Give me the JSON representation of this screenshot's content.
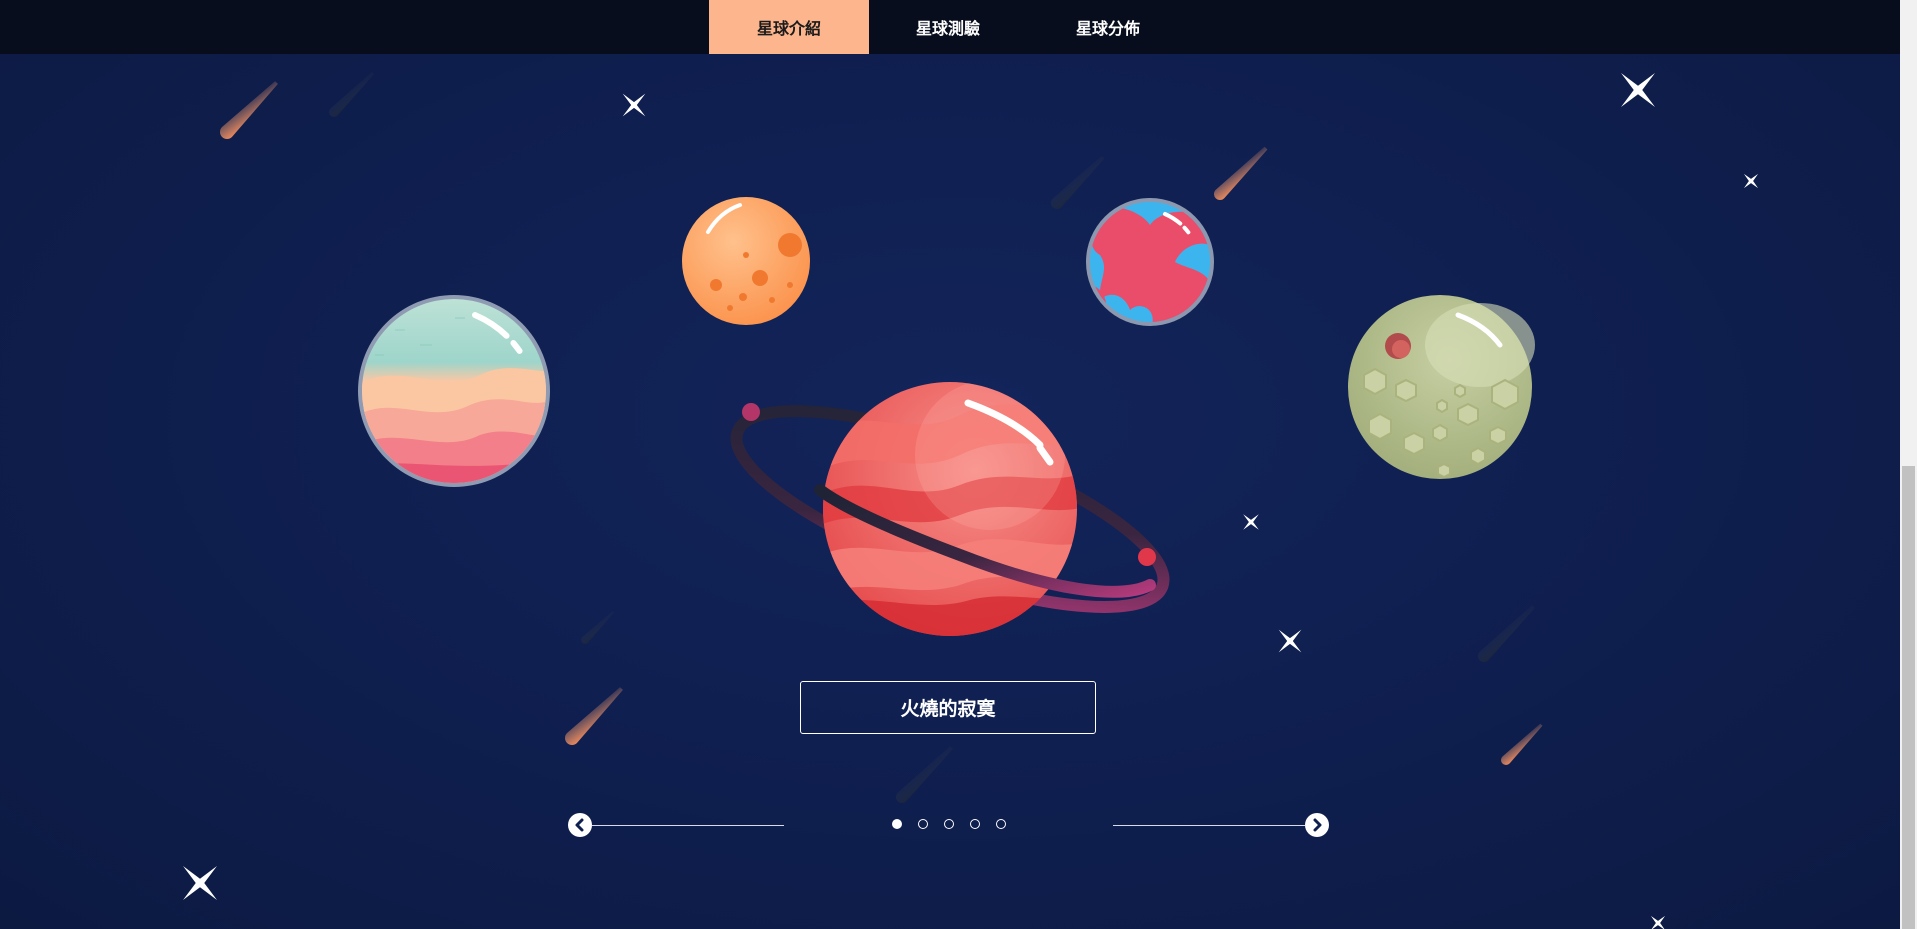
{
  "nav": {
    "tabs": [
      {
        "label": "星球介紹",
        "active": true
      },
      {
        "label": "星球測驗",
        "active": false
      },
      {
        "label": "星球分佈",
        "active": false
      }
    ]
  },
  "carousel": {
    "planet_title": "火燒的寂寞",
    "page_count": 5,
    "active_page": 1,
    "prev_icon": "chevron-left-icon",
    "next_icon": "chevron-right-icon"
  },
  "colors": {
    "navbar": "#080d1d",
    "active_tab": "#fcb58c",
    "background": "#0f1f50"
  }
}
